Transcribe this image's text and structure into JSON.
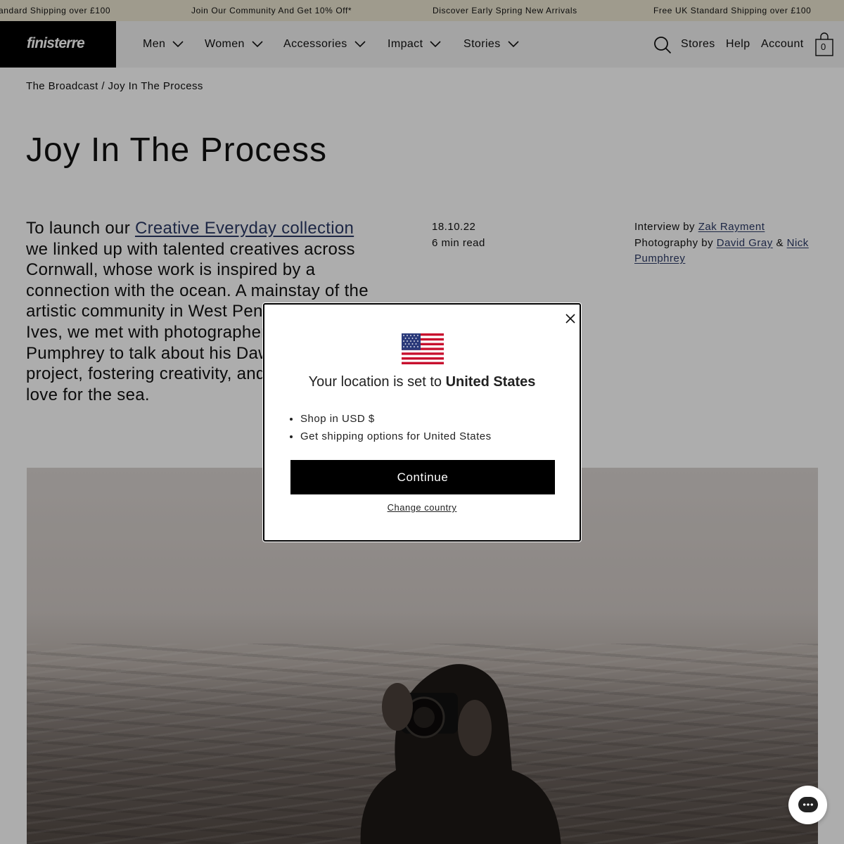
{
  "announcement": {
    "items": [
      "andard Shipping over £100",
      "Join Our Community And Get 10% Off*",
      "Discover Early Spring New Arrivals",
      "Free UK Standard Shipping over £100"
    ]
  },
  "header": {
    "logo": "finisterre",
    "nav": [
      "Men",
      "Women",
      "Accessories",
      "Impact",
      "Stories"
    ],
    "utility": {
      "stores": "Stores",
      "help": "Help",
      "account": "Account",
      "bag_count": "0"
    }
  },
  "breadcrumb": {
    "parent": "The Broadcast",
    "separator": "/",
    "current": "Joy In The Process"
  },
  "article": {
    "title": "Joy In The Process",
    "intro": {
      "lead": "To launch our ",
      "link": "Creative Everyday collection",
      "body": " we linked up with talented creatives across Cornwall, whose work is inspired by a connection with the ocean. A mainstay of the artistic community in West Penwith and St Ives, we met with photographer Nick Pumphrey to talk about his Dawn Days project, fostering creativity, and his undying love for the sea."
    },
    "date": "18.10.22",
    "read_time": "6 min read",
    "credits": {
      "interview_label": "Interview by ",
      "interviewer": "Zak Rayment",
      "photo_label": "Photography by ",
      "photographer_1": "David Gray",
      "amp": " & ",
      "photographer_2": "Nick Pumphrey"
    }
  },
  "modal": {
    "heading_prefix": "Your location is set to ",
    "country": "United States",
    "bullets": [
      "Shop in USD $",
      "Get shipping options for United States"
    ],
    "continue_label": "Continue",
    "change_label": "Change country"
  },
  "colors": {
    "announcement_bg": "#eae5d0",
    "link": "#2c3a66",
    "button": "#000000"
  },
  "icons": [
    "close-icon",
    "us-flag-icon",
    "search-icon",
    "bag-icon",
    "chevron-down-icon",
    "chat-icon"
  ]
}
